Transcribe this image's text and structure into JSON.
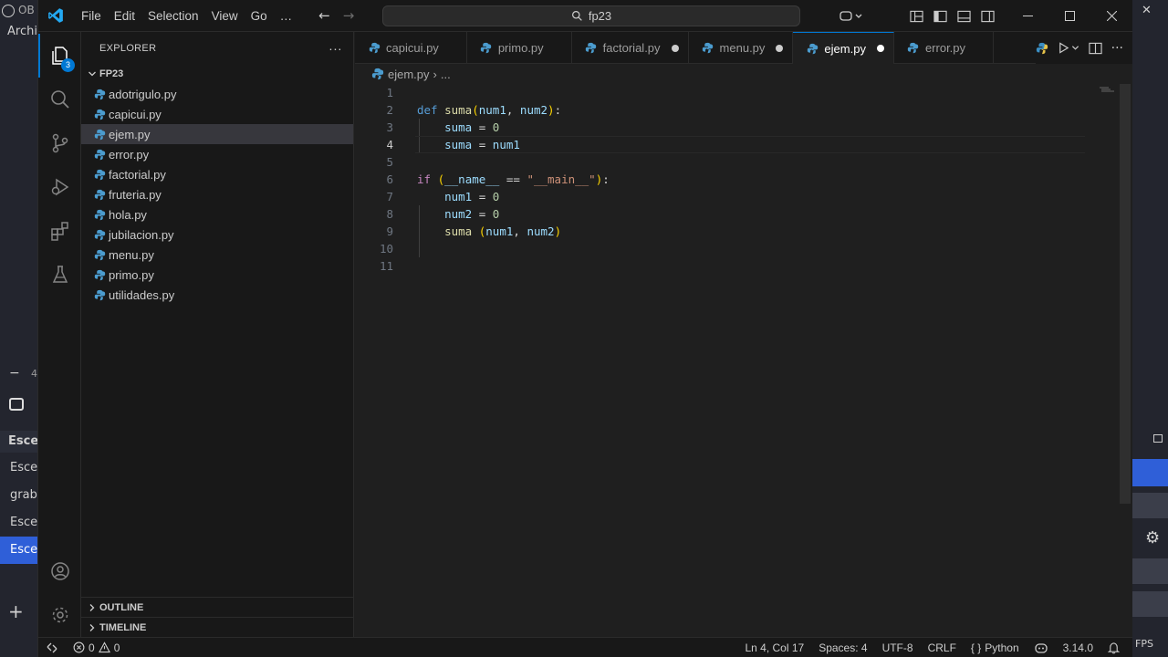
{
  "background_app": {
    "title_fragment": "OB",
    "menu_fragment": "Archiv",
    "zoom_fragment": "4",
    "scenes_header": "Escen",
    "scenes": [
      "Escen",
      "graba",
      "Escen",
      "Escen"
    ],
    "fps_fragment": "FPS"
  },
  "titlebar": {
    "menu": [
      "File",
      "Edit",
      "Selection",
      "View",
      "Go",
      "…"
    ],
    "search_text": "fp23"
  },
  "activity": {
    "explorer_badge": "3"
  },
  "sidebar": {
    "title": "EXPLORER",
    "more": "···",
    "folder": "FP23",
    "files": [
      "adotrigulo.py",
      "capicui.py",
      "ejem.py",
      "error.py",
      "factorial.py",
      "fruteria.py",
      "hola.py",
      "jubilacion.py",
      "menu.py",
      "primo.py",
      "utilidades.py"
    ],
    "selected_file": "ejem.py",
    "outline": "OUTLINE",
    "timeline": "TIMELINE"
  },
  "tabs": [
    {
      "label": "capicui.py",
      "modified": false,
      "active": false
    },
    {
      "label": "primo.py",
      "modified": false,
      "active": false
    },
    {
      "label": "factorial.py",
      "modified": true,
      "active": false
    },
    {
      "label": "menu.py",
      "modified": true,
      "active": false
    },
    {
      "label": "ejem.py",
      "modified": true,
      "active": true
    },
    {
      "label": "error.py",
      "modified": false,
      "active": false
    }
  ],
  "breadcrumb": {
    "file": "ejem.py",
    "rest": "..."
  },
  "code": {
    "line_numbers": [
      "1",
      "2",
      "3",
      "4",
      "5",
      "6",
      "7",
      "8",
      "9",
      "10",
      "11"
    ],
    "current_line": "4"
  },
  "status": {
    "errors": "0",
    "warnings": "0",
    "position": "Ln 4, Col 17",
    "spaces": "Spaces: 4",
    "encoding": "UTF-8",
    "eol": "CRLF",
    "language": "Python",
    "python_version": "3.14.0"
  },
  "colors": {
    "accent": "#0078d4",
    "keyword": "#569cd6",
    "function": "#dcdcaa",
    "variable": "#9cdcfe",
    "number": "#b5cea8",
    "string": "#ce9178"
  }
}
